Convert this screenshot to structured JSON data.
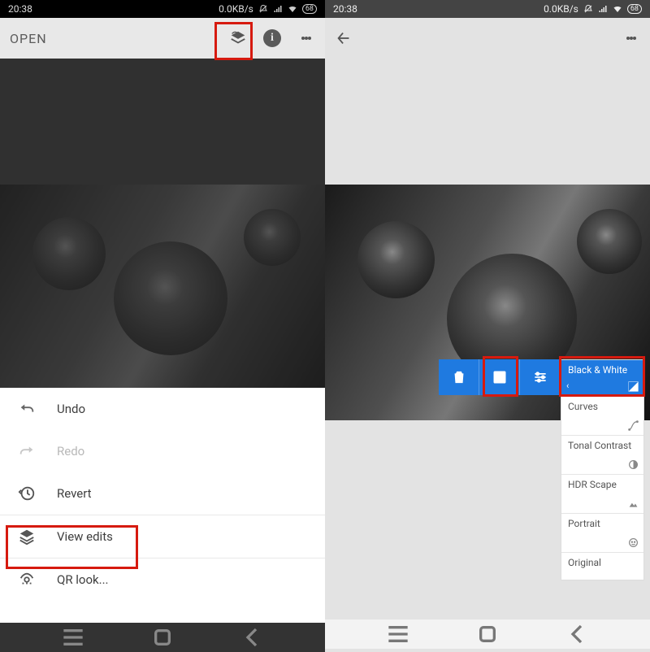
{
  "status": {
    "time": "20:38",
    "data_rate": "0.0KB/s",
    "battery": "68"
  },
  "left": {
    "open_label": "OPEN",
    "menu": {
      "undo": "Undo",
      "redo": "Redo",
      "revert": "Revert",
      "view_edits": "View edits",
      "qr_look": "QR look..."
    }
  },
  "right": {
    "toolbar": {
      "delete_icon": "delete",
      "edit_icon": "edit-box",
      "sliders_icon": "tune"
    },
    "stack": {
      "bw": "Black & White",
      "curves": "Curves",
      "tonal": "Tonal Contrast",
      "hdr": "HDR Scape",
      "portrait": "Portrait",
      "original": "Original"
    }
  },
  "icons": {
    "layers": "layers-icon",
    "info": "i",
    "kebab": "more-vert",
    "back": "arrow-left"
  }
}
